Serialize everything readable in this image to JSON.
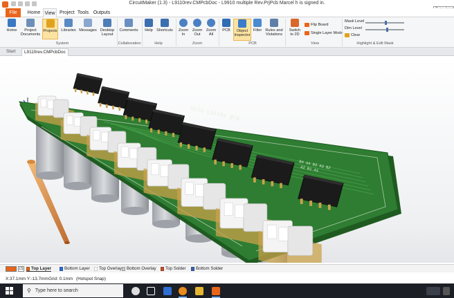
{
  "app": {
    "title": "CircuitMaker (1.3) - L9110rev.CMPcbDoc - L9910 multiple Rev.PrjPcb Marcel h is signed in.",
    "search_placeholder": "Type here",
    "accent": "#e8651b"
  },
  "ribbon": {
    "file_tab": "File",
    "tabs": [
      "Home",
      "View",
      "Project",
      "Tools",
      "Outputs"
    ],
    "active_tab": "View",
    "buttons": {
      "home": "Home",
      "project_documents": "Project Documents",
      "projects": "Projects",
      "libraries": "Libraries",
      "messages": "Messages",
      "desktop_layout": "Desktop Layout",
      "comments": "Comments",
      "help": "Help",
      "shortcuts": "Shortcuts",
      "zoom_in": "Zoom In",
      "zoom_out": "Zoom Out",
      "zoom_all": "Zoom All",
      "pcb": "PCB",
      "object_inspector": "Object Inspector",
      "filter": "Filter",
      "rules_violations": "Rules and Violations",
      "switch_2d": "Switch to 2D",
      "flip_board": "Flip Board",
      "single_layer_mode": "Single Layer Mode",
      "mask_level": "Mask Level",
      "dim_level": "Dim Level",
      "clear": "Clear"
    },
    "groups": {
      "system": "System",
      "collaboration": "Collaboration",
      "help": "Help",
      "zoom": "Zoom",
      "pcb": "PCB",
      "view": "View",
      "highlight_edit_mask": "Highlight & Edit Mask"
    }
  },
  "document_tabs": {
    "start": "Start",
    "active": "L9110rev.CMPcbDoc"
  },
  "board": {
    "silkscreen_title": "OCTA L9110s @CB",
    "silkscreen_block": [
      "B4 A4 B3 A3 B2",
      "A2 B1 A1"
    ],
    "board_color": "#2e7d32",
    "chip_count": 8,
    "connector_count": 8
  },
  "layers": {
    "current_swatch": "#e8651b",
    "ls_label": "LS",
    "items": [
      {
        "name": "Top Layer",
        "color": "#d2691e",
        "active": true
      },
      {
        "name": "Bottom Layer",
        "color": "#2b6cd1",
        "active": false
      },
      {
        "name": "Top Overlay",
        "color": "#ffffff",
        "active": false
      },
      {
        "name": "Bottom Overlay",
        "color": "#c8c8c8",
        "active": false
      },
      {
        "name": "Top Solder",
        "color": "#c0502a",
        "active": false
      },
      {
        "name": "Bottom Solder",
        "color": "#3a62a8",
        "active": false
      }
    ]
  },
  "status": {
    "coords": "X:37.1mm Y:-13.7mm",
    "grid": "Grid: 0.1mm",
    "snap": "(Hotspot Snap)"
  },
  "taskbar": {
    "search_placeholder": "Type here to search"
  }
}
